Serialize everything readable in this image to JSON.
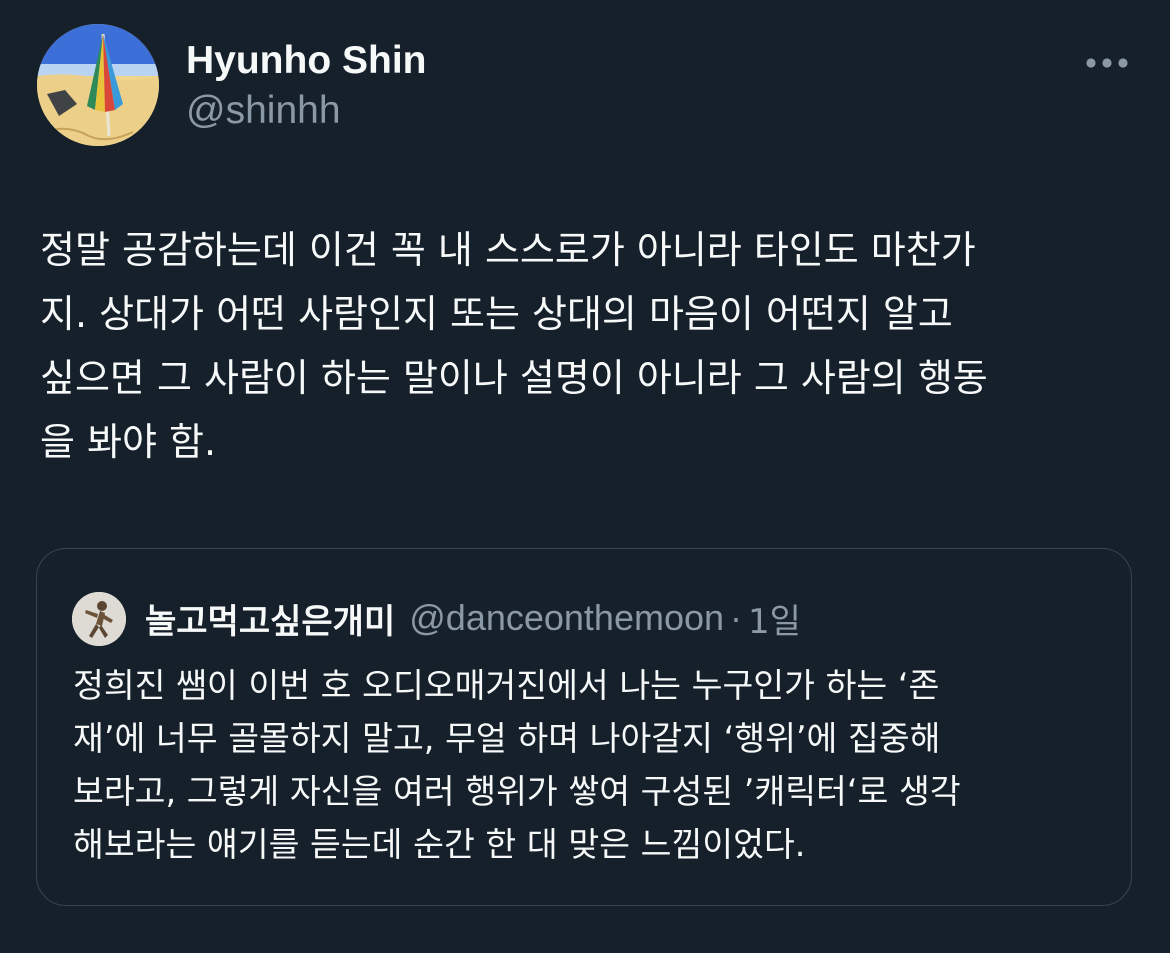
{
  "tweet": {
    "author": {
      "display_name": "Hyunho Shin",
      "handle": "@shinhh",
      "avatar_icon": "beach-umbrella-painting"
    },
    "more_icon": "ellipsis-icon",
    "text_lines": [
      "정말 공감하는데 이건 꼭 내 스스로가 아니라 타인도 마찬가",
      "지. 상대가 어떤 사람인지 또는 상대의 마음이 어떤지 알고",
      "싶으면 그 사람이 하는 말이나 설명이 아니라 그 사람의 행동",
      "을 봐야 함."
    ]
  },
  "quoted_tweet": {
    "author": {
      "display_name": "놀고먹고싶은개미",
      "handle": "@danceonthemoon",
      "avatar_icon": "dancing-figure"
    },
    "separator": "·",
    "timestamp": "1일",
    "text_lines": [
      "정희진 쌤이 이번 호 오디오매거진에서 나는 누구인가 하는 ‘존",
      "재’에 너무 골몰하지 말고, 무얼 하며 나아갈지 ‘행위’에 집중해",
      "보라고, 그렇게 자신을 여러 행위가 쌓여 구성된 ’캐릭터‘로 생각",
      "해보라는 얘기를 듣는데 순간 한 대 맞은 느낌이었다."
    ]
  },
  "colors": {
    "background": "#15202b",
    "primary_text": "#f7f9f9",
    "secondary_text": "#8b98a5",
    "border": "#38444d"
  }
}
